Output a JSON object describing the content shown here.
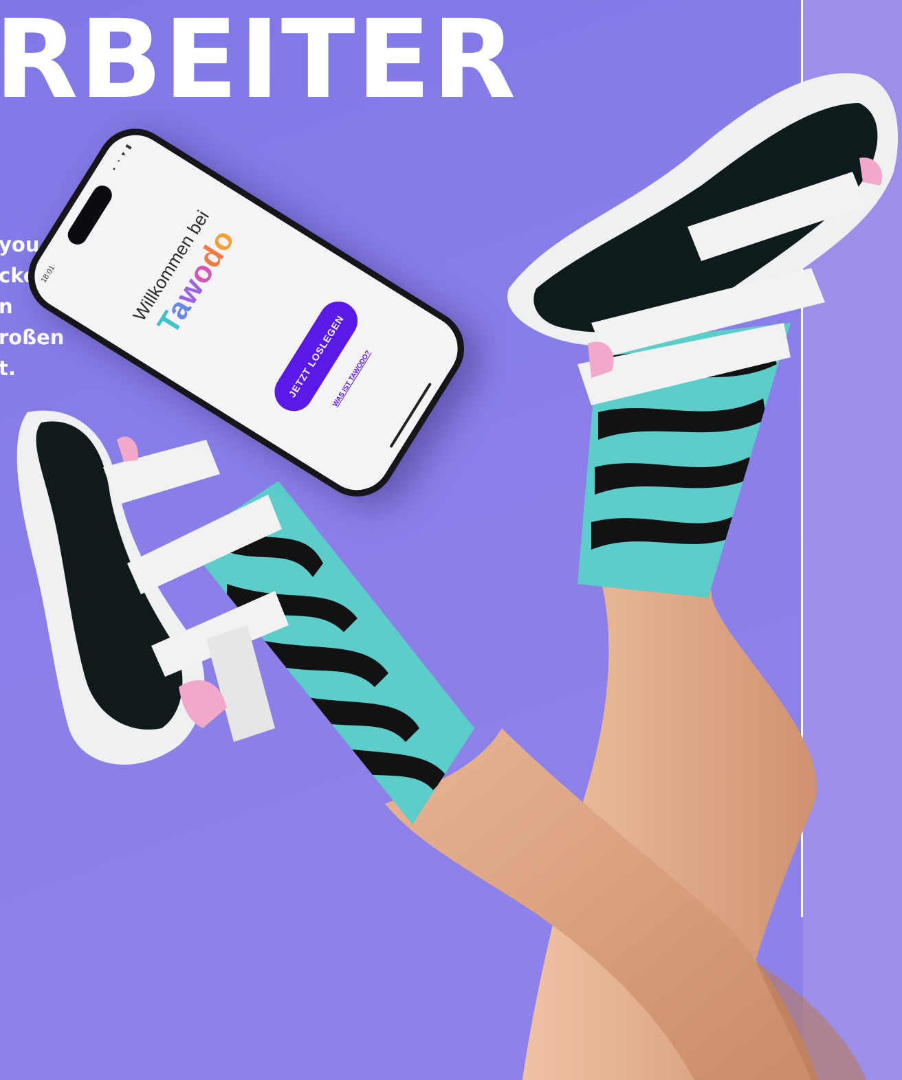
{
  "headline": "RBEITER",
  "intro_lines": [
    "you",
    "ckelt,",
    "n",
    "roßen",
    "t."
  ],
  "phone": {
    "status_time": "18:01",
    "status_icons": "• ◔ ▾ ▮",
    "welcome": "Willkommen bei",
    "brand": "Tawodo",
    "cta_button": "JETZT LOSLEGEN",
    "link": "WAS IST TAWODO?",
    "brand_colors": [
      "#3fc2c8",
      "#6a86e6",
      "#9c63e0",
      "#d456b3",
      "#ee7a45",
      "#f0a037"
    ],
    "button_color": "#5a19e6"
  },
  "colors": {
    "background": "#8a7fe8",
    "right_panel": "#9d8fe8",
    "sock_teal": "#5ccdc9",
    "stripe_black": "#121214"
  }
}
